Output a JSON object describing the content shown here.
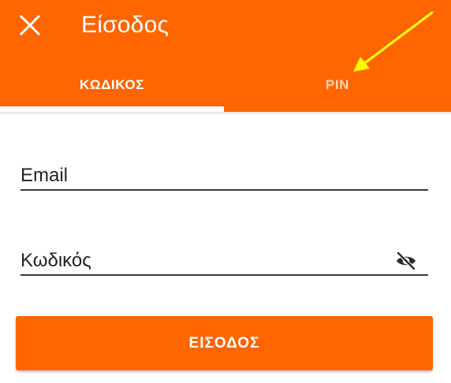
{
  "header": {
    "title": "Είσοδος",
    "close_icon": "close-icon"
  },
  "tabs": [
    {
      "label": "ΚΩΔΙΚΟΣ",
      "selected": true
    },
    {
      "label": "PIN",
      "selected": false
    }
  ],
  "form": {
    "email": {
      "placeholder": "Email",
      "value": ""
    },
    "password": {
      "placeholder": "Κωδικός",
      "value": "",
      "visibility_icon": "eye-off-icon"
    }
  },
  "submit_label": "ΕΙΣΟΔΟΣ",
  "colors": {
    "accent": "#ff6600",
    "annotation_arrow": "#ffff00",
    "field_underline": "#3a3a3a"
  }
}
